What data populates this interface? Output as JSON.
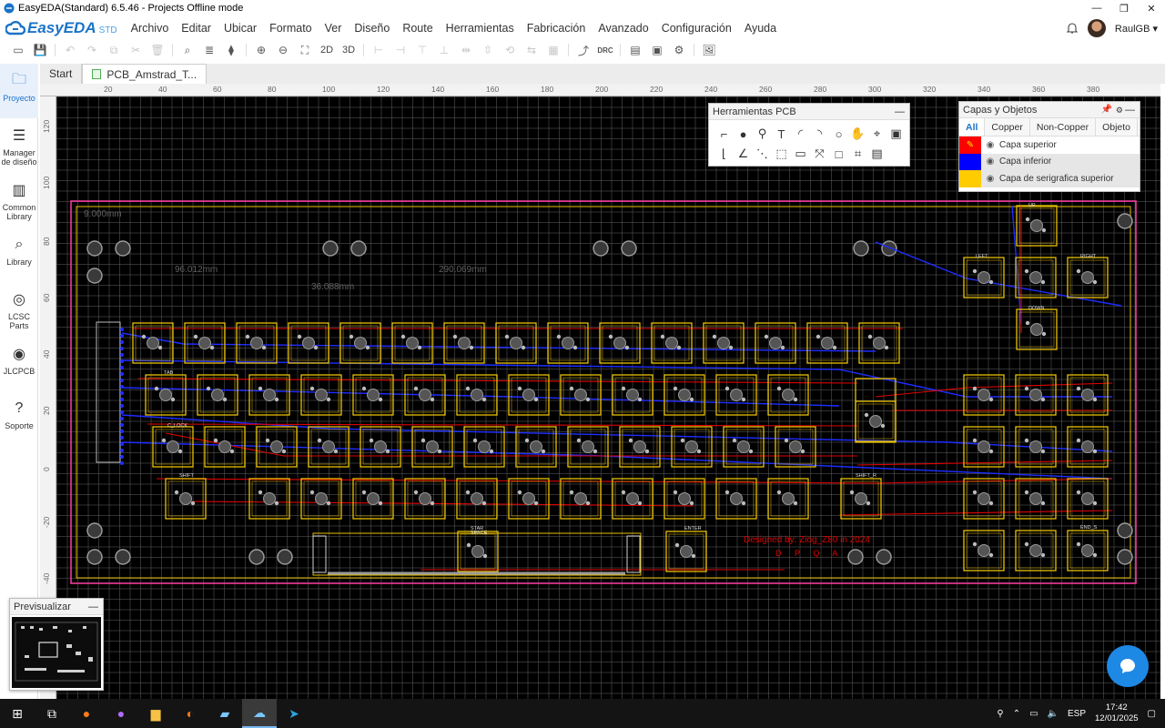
{
  "window": {
    "title": "EasyEDA(Standard) 6.5.46 - Projects Offline mode",
    "controls": [
      "—",
      "❐",
      "✕"
    ]
  },
  "brand": {
    "name": "EasyEDA",
    "edition": "STD"
  },
  "menu": [
    "Archivo",
    "Editar",
    "Ubicar",
    "Formato",
    "Ver",
    "Diseño",
    "Route",
    "Herramientas",
    "Fabricación",
    "Avanzado",
    "Configuración",
    "Ayuda"
  ],
  "user": {
    "name": "RaulGB ▾"
  },
  "toolbar": {
    "view_2d": "2D",
    "view_3d": "3D",
    "drc": "DRC"
  },
  "sidebar": [
    {
      "label": "Proyecto",
      "icon": "folder-icon",
      "active": true
    },
    {
      "label": "Manager de diseño",
      "icon": "list-icon"
    },
    {
      "label": "Common Library",
      "icon": "chip-icon"
    },
    {
      "label": "Library",
      "icon": "library-search-icon"
    },
    {
      "label": "LCSC Parts",
      "icon": "lcsc-icon"
    },
    {
      "label": "JLCPCB",
      "icon": "jlcpcb-icon"
    },
    {
      "label": "Soporte",
      "icon": "help-icon"
    }
  ],
  "tabs": [
    {
      "label": "Start"
    },
    {
      "label": "PCB_Amstrad_T...",
      "active": true
    }
  ],
  "ruler": {
    "top": [
      "20",
      "40",
      "60",
      "80",
      "100",
      "120",
      "140",
      "160",
      "180",
      "200",
      "220",
      "240",
      "260",
      "280",
      "300",
      "320",
      "340",
      "360",
      "380"
    ],
    "left": [
      "120",
      "100",
      "80",
      "60",
      "40",
      "20",
      "0",
      "-20",
      "-40"
    ]
  },
  "board": {
    "silkscreen_text": "Designed by: Ziog_Z80 in 2024",
    "silkscreen_initials": "D  P  Q  A",
    "dimensions": [
      "9.000mm",
      "96.012mm",
      "290.069mm",
      "36.088mm"
    ],
    "key_labels": [
      "TAB",
      "C_LOCK",
      "SHIFT",
      "SHIFT_R",
      "STAR",
      "SPACE",
      "ENTER",
      "END_S",
      "LEFT",
      "RIGHT",
      "DOWN",
      "UP"
    ]
  },
  "pcb_tools": {
    "title": "Herramientas PCB",
    "tools": [
      "⌐",
      "●",
      "⚲",
      "T",
      "◜",
      "◝",
      "○",
      "✋",
      "⌖",
      "▣",
      "⌊",
      "∠",
      "⋱",
      "⬚",
      "▭",
      "⤧",
      "□",
      "⌗",
      "▤"
    ]
  },
  "layers": {
    "title": "Capas y Objetos",
    "tabs": [
      "All",
      "Copper",
      "Non-Copper",
      "Objeto"
    ],
    "rows": [
      {
        "name": "Capa superior",
        "color": "#ff0000"
      },
      {
        "name": "Capa inferior",
        "color": "#0000ff"
      },
      {
        "name": "Capa de serigrafica superior",
        "color": "#ffcc00"
      }
    ]
  },
  "preview": {
    "title": "Previsualizar"
  },
  "taskbar": {
    "lang": "ESP",
    "time": "17:42",
    "date": "12/01/2025"
  },
  "colors": {
    "accent": "#1a73c8",
    "board_outline": "#ff3ea5",
    "silkscreen": "#e8c000",
    "top_copper": "#e00000",
    "bottom_copper": "#1e2dff"
  }
}
